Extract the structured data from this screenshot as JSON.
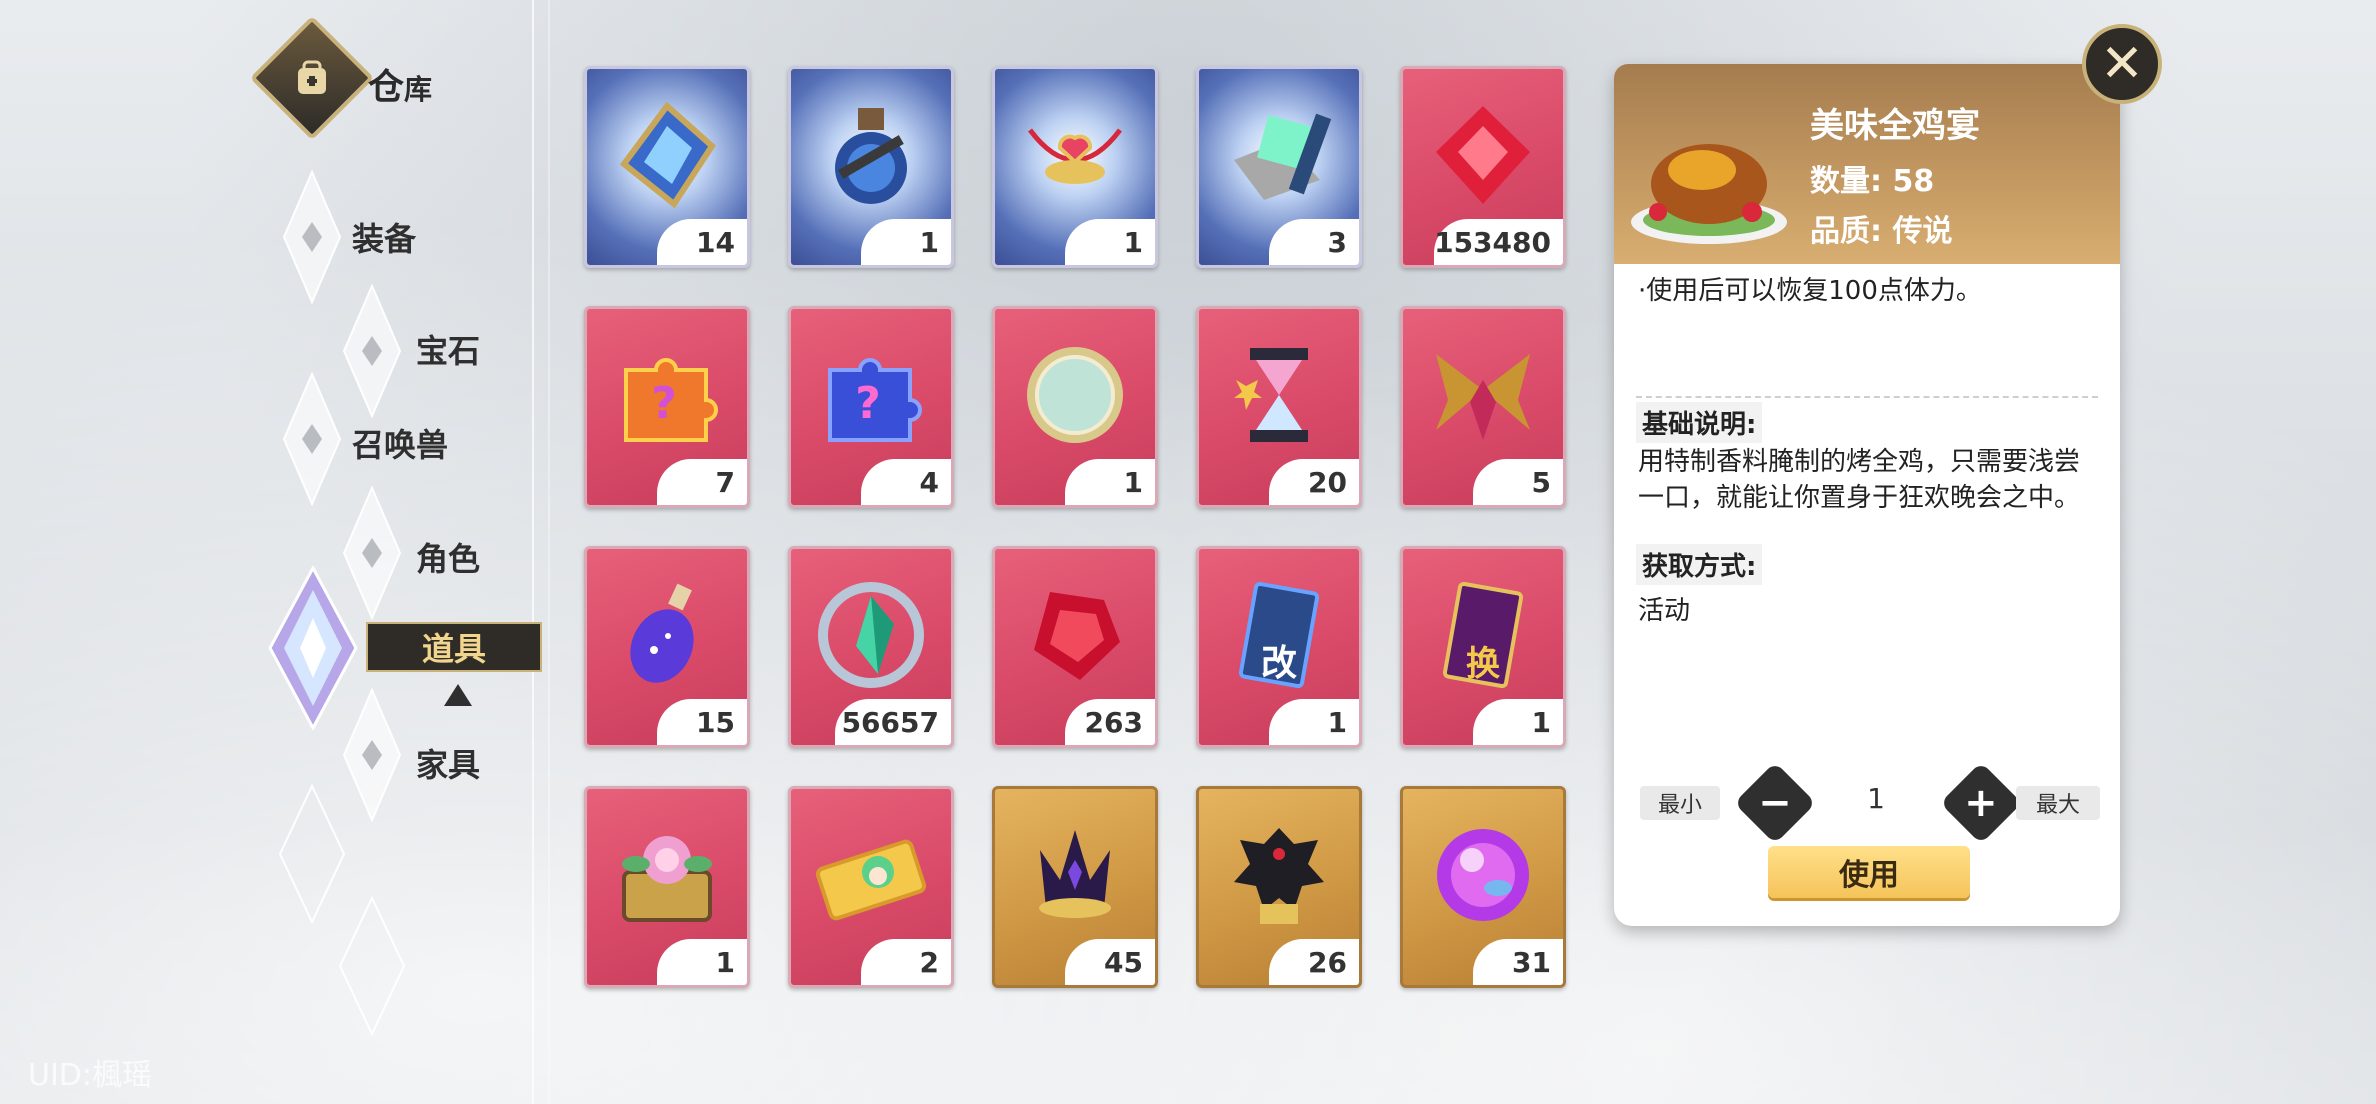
{
  "sidebar": {
    "warehouse_title_main": "仓",
    "warehouse_title_sub": "库",
    "categories": [
      {
        "label": "装备"
      },
      {
        "label": "宝石"
      },
      {
        "label": "召唤兽"
      },
      {
        "label": "角色"
      },
      {
        "label": "道具",
        "active": true
      },
      {
        "label": "家具"
      }
    ],
    "uid": "UID:楓瑶"
  },
  "items": [
    {
      "name": "blue-crystal-shard",
      "bg": "blue",
      "icon": "crystal-frame-icon",
      "count": "14"
    },
    {
      "name": "blue-potion-flask",
      "bg": "blue",
      "icon": "potion-icon",
      "count": "1"
    },
    {
      "name": "heart-necklace",
      "bg": "blue",
      "icon": "necklace-icon",
      "count": "1"
    },
    {
      "name": "prism-scroll",
      "bg": "blue",
      "icon": "scroll-icon",
      "count": "3"
    },
    {
      "name": "red-gem",
      "bg": "pink",
      "icon": "red-gem-icon",
      "count": "153480"
    },
    {
      "name": "orange-puzzle",
      "bg": "pink",
      "icon": "orange-puzzle-icon",
      "count": "7"
    },
    {
      "name": "blue-puzzle",
      "bg": "pink",
      "icon": "blue-puzzle-icon",
      "count": "4"
    },
    {
      "name": "golden-coin",
      "bg": "pink",
      "icon": "coin-icon",
      "count": "1"
    },
    {
      "name": "hourglass",
      "bg": "pink",
      "icon": "hourglass-icon",
      "count": "20"
    },
    {
      "name": "golden-wings",
      "bg": "pink",
      "icon": "wings-icon",
      "count": "5"
    },
    {
      "name": "purple-bottle",
      "bg": "pink",
      "icon": "bottle-icon",
      "count": "15"
    },
    {
      "name": "green-crystal",
      "bg": "pink",
      "icon": "green-crystal-icon",
      "count": "56657"
    },
    {
      "name": "ruby",
      "bg": "pink",
      "icon": "ruby-icon",
      "count": "263"
    },
    {
      "name": "modify-card",
      "bg": "pink",
      "icon": "modify-card-icon",
      "count": "1",
      "glyph": "改"
    },
    {
      "name": "swap-card",
      "bg": "pink",
      "icon": "swap-card-icon",
      "count": "1",
      "glyph": "换"
    },
    {
      "name": "flower-chest",
      "bg": "pink",
      "icon": "flower-chest-icon",
      "count": "1"
    },
    {
      "name": "character-ticket",
      "bg": "pink",
      "icon": "ticket-icon",
      "count": "2"
    },
    {
      "name": "dark-crown",
      "bg": "gold",
      "icon": "crown-icon",
      "count": "45"
    },
    {
      "name": "dark-figure",
      "bg": "gold",
      "icon": "figure-icon",
      "count": "26"
    },
    {
      "name": "purple-orb",
      "bg": "gold",
      "icon": "orb-icon",
      "count": "31"
    }
  ],
  "detail": {
    "name": "美味全鸡宴",
    "quantity": "数量: 58",
    "quality": "品质: 传说",
    "effect": "·使用后可以恢复100点体力。",
    "basic_label": "基础说明:",
    "description": "用特制香料腌制的烤全鸡，只需要浅尝一口，就能让你置身于狂欢晚会之中。",
    "source_label": "获取方式:",
    "source": "活动",
    "min_label": "最小",
    "max_label": "最大",
    "amount": "1",
    "use_label": "使用",
    "food_icon": "roast-chicken-icon",
    "header_color": "#c59a62"
  },
  "close_symbol": "✕"
}
